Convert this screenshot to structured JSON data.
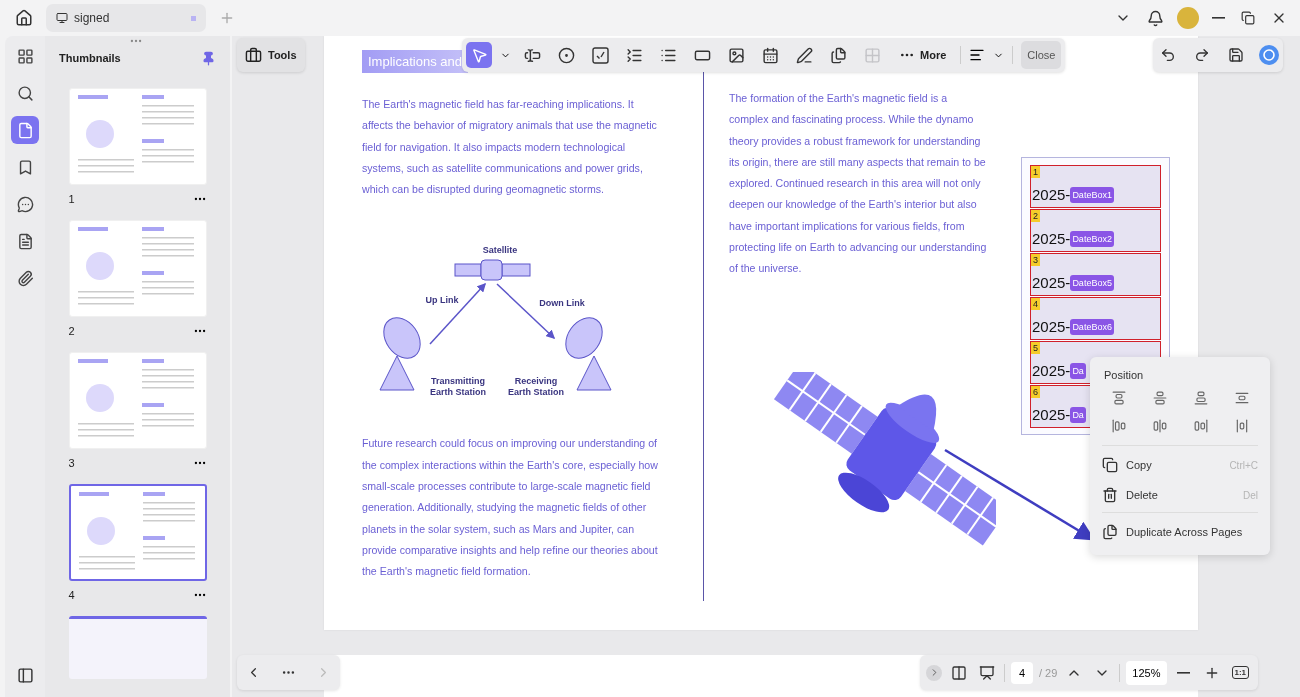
{
  "tab": {
    "title": "signed"
  },
  "rail": [
    {
      "selected": false
    },
    {
      "selected": false
    },
    {
      "selected": true
    },
    {
      "selected": false
    },
    {
      "selected": false
    },
    {
      "selected": false
    },
    {
      "selected": false
    }
  ],
  "thumbnails": {
    "title": "Thumbnails",
    "pages": [
      {
        "number": "1",
        "selected": false
      },
      {
        "number": "2",
        "selected": false
      },
      {
        "number": "3",
        "selected": false
      },
      {
        "number": "4",
        "selected": true
      }
    ]
  },
  "tools_button": "Tools",
  "toolbar": {
    "tools": [
      {
        "selected": true,
        "disabled": false
      },
      {
        "selected": false,
        "disabled": false
      },
      {
        "selected": false,
        "disabled": false
      },
      {
        "selected": false,
        "disabled": false
      },
      {
        "selected": false,
        "disabled": false
      },
      {
        "selected": false,
        "disabled": false
      },
      {
        "selected": false,
        "disabled": false
      },
      {
        "selected": false,
        "disabled": false
      },
      {
        "selected": false,
        "disabled": false
      },
      {
        "selected": false,
        "disabled": false
      },
      {
        "selected": false,
        "disabled": false
      },
      {
        "selected": false,
        "disabled": true
      }
    ],
    "more": "More",
    "close": "Close"
  },
  "document": {
    "heading": "Implications and",
    "left_paragraphs": [
      "The Earth's magnetic field has far-reaching implications. It affects the behavior of migratory animals that use the magnetic field for navigation. It also impacts modern technological systems, such as satellite communications and power grids, which can be disrupted during geomagnetic storms.",
      "Future research could focus on improving our understanding of the complex interactions within the Earth's core, especially how small-scale processes contribute to large-scale magnetic field generation. Additionally, studying the magnetic fields of other planets in the solar system, such as Mars and Jupiter, can provide comparative insights and help refine our theories about the Earth's magnetic field formation."
    ],
    "right_paragraph": "The formation of the Earth's magnetic field is a complex and fascinating process. While the dynamo theory provides a robust framework for understanding its origin, there are still many aspects that remain to be explored. Continued research in this area will not only deepen our knowledge of the Earth's interior but also have important implications for various fields, from protecting life on Earth to advancing our understanding of the universe.",
    "diagram_labels": [
      "Satellite",
      "Up Link",
      "Down Link",
      "Transmitting Earth Station",
      "Receiving Earth Station"
    ],
    "date_fields": [
      {
        "number": "1",
        "value": "2025-",
        "tag": "DateBox1"
      },
      {
        "number": "2",
        "value": "2025-",
        "tag": "DateBox2"
      },
      {
        "number": "3",
        "value": "2025-",
        "tag": "DateBox5"
      },
      {
        "number": "4",
        "value": "2025-",
        "tag": "DateBox6"
      },
      {
        "number": "5",
        "value": "2025-",
        "tag": "Da"
      },
      {
        "number": "6",
        "value": "2025-",
        "tag": "Da"
      }
    ]
  },
  "context_menu": {
    "title": "Position",
    "items": [
      {
        "label": "Copy",
        "shortcut": "Ctrl+C"
      },
      {
        "label": "Delete",
        "shortcut": "Del"
      },
      {
        "label": "Duplicate Across Pages"
      }
    ]
  },
  "page_nav": {
    "current": "4",
    "total": "/ 29",
    "zoom": "125%",
    "actual_size": "1:1"
  }
}
